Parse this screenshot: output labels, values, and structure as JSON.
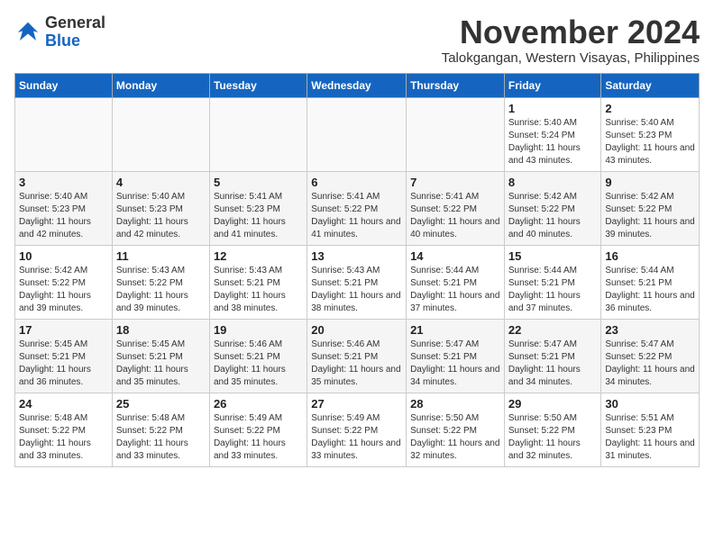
{
  "logo": {
    "general": "General",
    "blue": "Blue"
  },
  "title": "November 2024",
  "subtitle": "Talokgangan, Western Visayas, Philippines",
  "weekdays": [
    "Sunday",
    "Monday",
    "Tuesday",
    "Wednesday",
    "Thursday",
    "Friday",
    "Saturday"
  ],
  "weeks": [
    [
      {
        "day": "",
        "detail": ""
      },
      {
        "day": "",
        "detail": ""
      },
      {
        "day": "",
        "detail": ""
      },
      {
        "day": "",
        "detail": ""
      },
      {
        "day": "",
        "detail": ""
      },
      {
        "day": "1",
        "detail": "Sunrise: 5:40 AM\nSunset: 5:24 PM\nDaylight: 11 hours and 43 minutes."
      },
      {
        "day": "2",
        "detail": "Sunrise: 5:40 AM\nSunset: 5:23 PM\nDaylight: 11 hours and 43 minutes."
      }
    ],
    [
      {
        "day": "3",
        "detail": "Sunrise: 5:40 AM\nSunset: 5:23 PM\nDaylight: 11 hours and 42 minutes."
      },
      {
        "day": "4",
        "detail": "Sunrise: 5:40 AM\nSunset: 5:23 PM\nDaylight: 11 hours and 42 minutes."
      },
      {
        "day": "5",
        "detail": "Sunrise: 5:41 AM\nSunset: 5:23 PM\nDaylight: 11 hours and 41 minutes."
      },
      {
        "day": "6",
        "detail": "Sunrise: 5:41 AM\nSunset: 5:22 PM\nDaylight: 11 hours and 41 minutes."
      },
      {
        "day": "7",
        "detail": "Sunrise: 5:41 AM\nSunset: 5:22 PM\nDaylight: 11 hours and 40 minutes."
      },
      {
        "day": "8",
        "detail": "Sunrise: 5:42 AM\nSunset: 5:22 PM\nDaylight: 11 hours and 40 minutes."
      },
      {
        "day": "9",
        "detail": "Sunrise: 5:42 AM\nSunset: 5:22 PM\nDaylight: 11 hours and 39 minutes."
      }
    ],
    [
      {
        "day": "10",
        "detail": "Sunrise: 5:42 AM\nSunset: 5:22 PM\nDaylight: 11 hours and 39 minutes."
      },
      {
        "day": "11",
        "detail": "Sunrise: 5:43 AM\nSunset: 5:22 PM\nDaylight: 11 hours and 39 minutes."
      },
      {
        "day": "12",
        "detail": "Sunrise: 5:43 AM\nSunset: 5:21 PM\nDaylight: 11 hours and 38 minutes."
      },
      {
        "day": "13",
        "detail": "Sunrise: 5:43 AM\nSunset: 5:21 PM\nDaylight: 11 hours and 38 minutes."
      },
      {
        "day": "14",
        "detail": "Sunrise: 5:44 AM\nSunset: 5:21 PM\nDaylight: 11 hours and 37 minutes."
      },
      {
        "day": "15",
        "detail": "Sunrise: 5:44 AM\nSunset: 5:21 PM\nDaylight: 11 hours and 37 minutes."
      },
      {
        "day": "16",
        "detail": "Sunrise: 5:44 AM\nSunset: 5:21 PM\nDaylight: 11 hours and 36 minutes."
      }
    ],
    [
      {
        "day": "17",
        "detail": "Sunrise: 5:45 AM\nSunset: 5:21 PM\nDaylight: 11 hours and 36 minutes."
      },
      {
        "day": "18",
        "detail": "Sunrise: 5:45 AM\nSunset: 5:21 PM\nDaylight: 11 hours and 35 minutes."
      },
      {
        "day": "19",
        "detail": "Sunrise: 5:46 AM\nSunset: 5:21 PM\nDaylight: 11 hours and 35 minutes."
      },
      {
        "day": "20",
        "detail": "Sunrise: 5:46 AM\nSunset: 5:21 PM\nDaylight: 11 hours and 35 minutes."
      },
      {
        "day": "21",
        "detail": "Sunrise: 5:47 AM\nSunset: 5:21 PM\nDaylight: 11 hours and 34 minutes."
      },
      {
        "day": "22",
        "detail": "Sunrise: 5:47 AM\nSunset: 5:21 PM\nDaylight: 11 hours and 34 minutes."
      },
      {
        "day": "23",
        "detail": "Sunrise: 5:47 AM\nSunset: 5:22 PM\nDaylight: 11 hours and 34 minutes."
      }
    ],
    [
      {
        "day": "24",
        "detail": "Sunrise: 5:48 AM\nSunset: 5:22 PM\nDaylight: 11 hours and 33 minutes."
      },
      {
        "day": "25",
        "detail": "Sunrise: 5:48 AM\nSunset: 5:22 PM\nDaylight: 11 hours and 33 minutes."
      },
      {
        "day": "26",
        "detail": "Sunrise: 5:49 AM\nSunset: 5:22 PM\nDaylight: 11 hours and 33 minutes."
      },
      {
        "day": "27",
        "detail": "Sunrise: 5:49 AM\nSunset: 5:22 PM\nDaylight: 11 hours and 33 minutes."
      },
      {
        "day": "28",
        "detail": "Sunrise: 5:50 AM\nSunset: 5:22 PM\nDaylight: 11 hours and 32 minutes."
      },
      {
        "day": "29",
        "detail": "Sunrise: 5:50 AM\nSunset: 5:22 PM\nDaylight: 11 hours and 32 minutes."
      },
      {
        "day": "30",
        "detail": "Sunrise: 5:51 AM\nSunset: 5:23 PM\nDaylight: 11 hours and 31 minutes."
      }
    ]
  ]
}
